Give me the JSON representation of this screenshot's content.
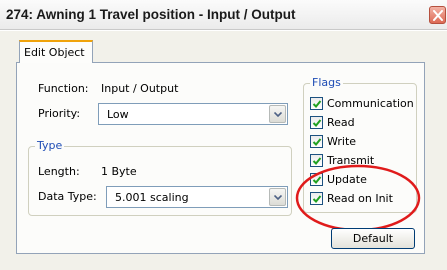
{
  "window": {
    "title": "274: Awning 1 Travel position - Input / Output"
  },
  "tabs": [
    {
      "label": "Edit Object",
      "active": true
    }
  ],
  "fields": {
    "function_label": "Function:",
    "function_value": "Input / Output",
    "priority_label": "Priority:",
    "priority_value": "Low"
  },
  "type_group": {
    "title": "Type",
    "length_label": "Length:",
    "length_value": "1 Byte",
    "data_type_label": "Data Type:",
    "data_type_value": "5.001 scaling"
  },
  "flags": {
    "title": "Flags",
    "items": [
      {
        "label": "Communication",
        "checked": true
      },
      {
        "label": "Read",
        "checked": true
      },
      {
        "label": "Write",
        "checked": true
      },
      {
        "label": "Transmit",
        "checked": true
      },
      {
        "label": "Update",
        "checked": true
      },
      {
        "label": "Read on Init",
        "checked": true
      }
    ]
  },
  "buttons": {
    "default_label": "Default"
  },
  "colors": {
    "group_title": "#1f4db5",
    "tab_highlight": "#f0a30a",
    "annotation_circle": "#e01b1b",
    "checkmark": "#21a121"
  }
}
